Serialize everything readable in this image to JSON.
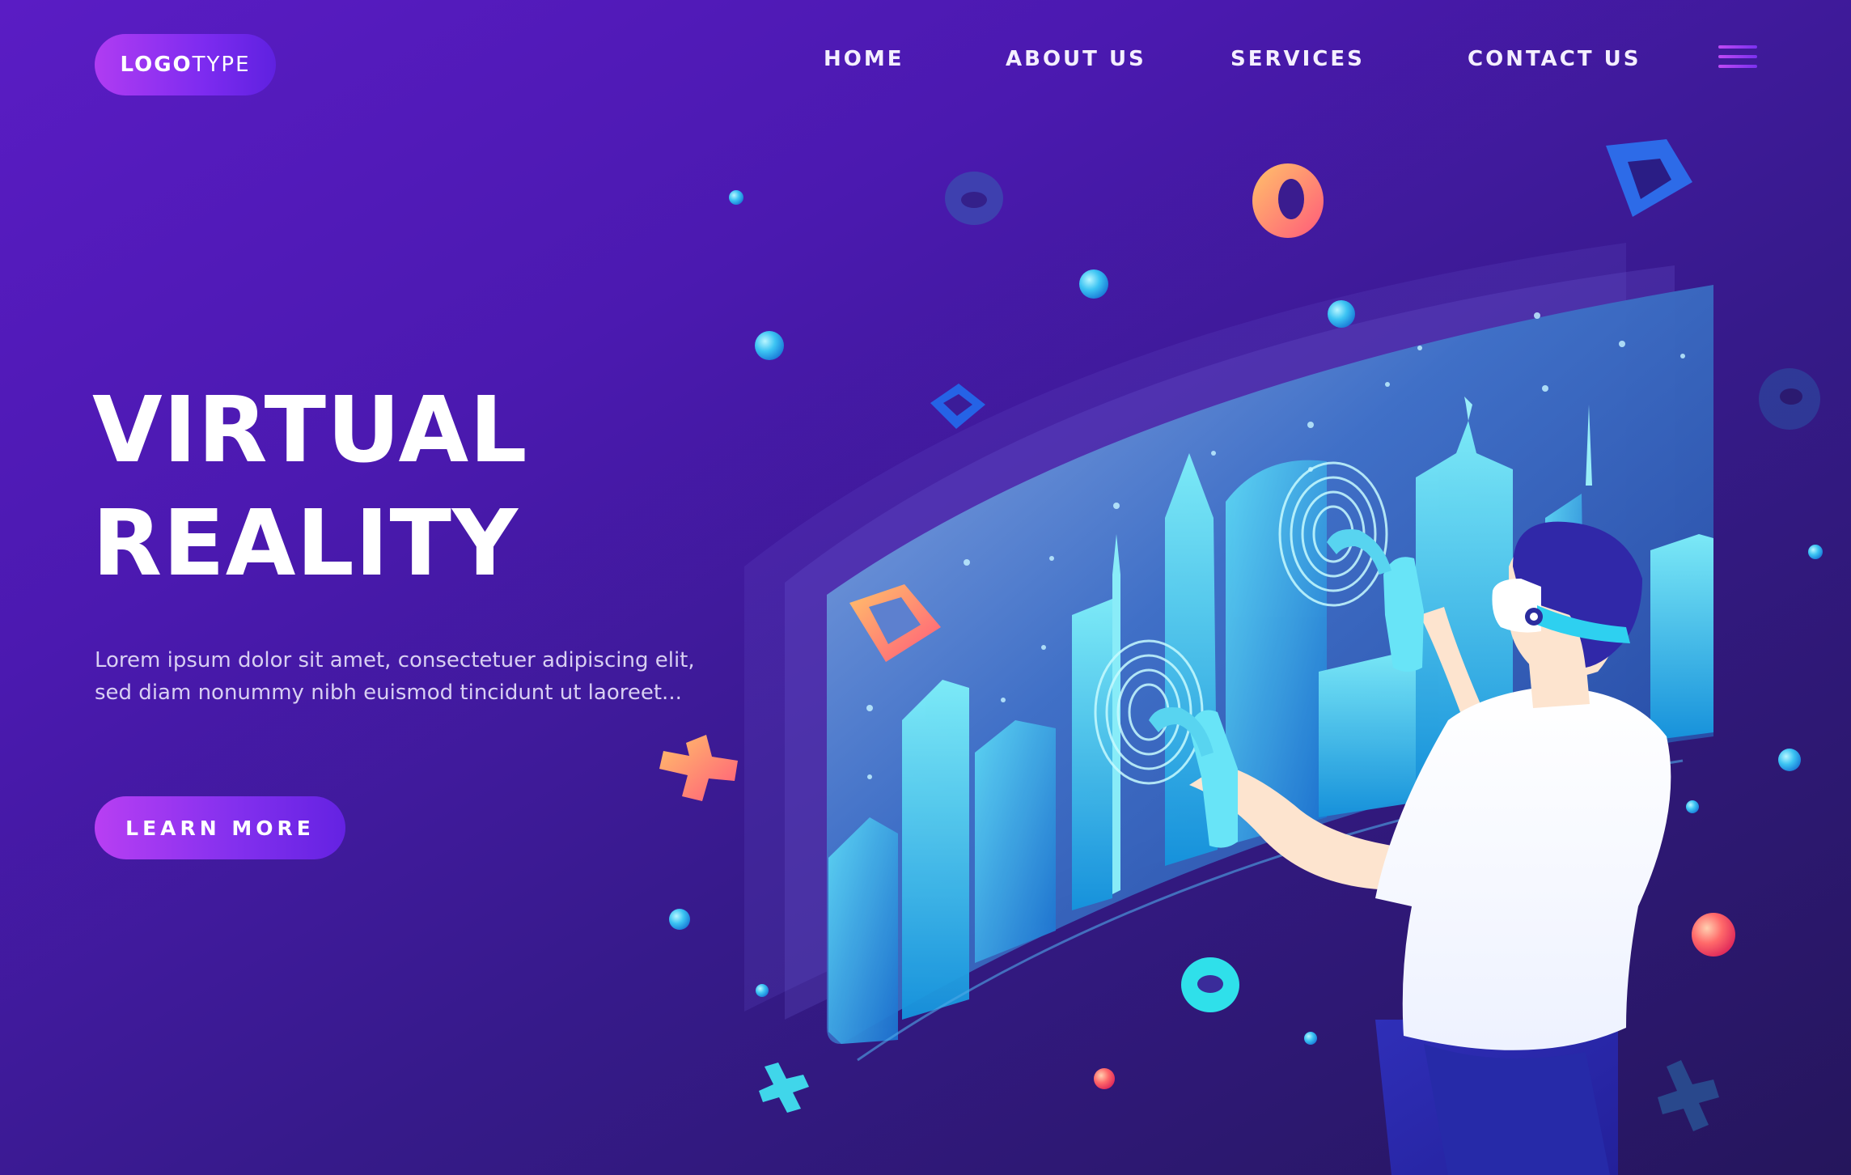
{
  "brand": {
    "logo_bold": "LOGO",
    "logo_light": "TYPE"
  },
  "nav": {
    "items": [
      {
        "label": "HOME"
      },
      {
        "label": "ABOUT US"
      },
      {
        "label": "SERVICES"
      },
      {
        "label": "CONTACT US"
      }
    ],
    "menu_icon": "hamburger-menu-icon"
  },
  "hero": {
    "title_line1": "VIRTUAL",
    "title_line2": "REALITY",
    "body": "Lorem ipsum dolor sit amet, consectetuer adipiscing elit, sed diam nonummy nibh euismod tincidunt ut laoreet...",
    "cta_label": "LEARN MORE"
  },
  "illustration": {
    "subject": "person-wearing-vr-headset-with-controllers",
    "scene": "curved-holographic-city-skyline-screen",
    "decorations": [
      "torus-icon",
      "square-ring-icon",
      "cross-icon",
      "sphere-icon"
    ]
  },
  "colors": {
    "background_top_left": "#5a1cc4",
    "background_bottom_right": "#25165c",
    "accent_gradient_start": "#b83ff3",
    "accent_gradient_end": "#6422e2",
    "screen_cyan": "#4fd6f2",
    "screen_blue": "#1f78d6",
    "decor_orange": "#ff8a5c",
    "decor_coral": "#ff5a7a"
  }
}
